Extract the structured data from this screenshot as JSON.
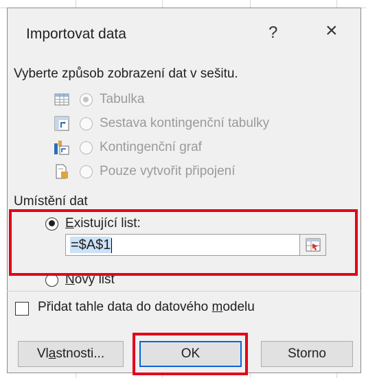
{
  "dialog": {
    "title": "Importovat data",
    "help_label": "?",
    "close_label": "×",
    "display_section": {
      "label": "Vyberte způsob zobrazení dat v sešitu.",
      "options": [
        {
          "icon": "table-icon",
          "label": "Tabulka",
          "selected": true,
          "enabled": false
        },
        {
          "icon": "pivot-table-icon",
          "label": "Sestava kontingenční tabulky",
          "selected": false,
          "enabled": false
        },
        {
          "icon": "pivot-chart-icon",
          "label": "Kontingenční graf",
          "selected": false,
          "enabled": false
        },
        {
          "icon": "connection-icon",
          "label": "Pouze vytvořit připojení",
          "selected": false,
          "enabled": false
        }
      ]
    },
    "location_section": {
      "label": "Umístění dat",
      "existing_sheet": {
        "label_prefix": "E",
        "label_rest": "xistující list:",
        "selected": true
      },
      "reference_value": "=$A$1",
      "new_sheet": {
        "label_prefix": "N",
        "label_rest": "ový list",
        "selected": false
      }
    },
    "data_model_checkbox": {
      "label_start": "Přidat tahle data do datového ",
      "label_hotkey": "m",
      "label_end": "odelu",
      "checked": false
    },
    "buttons": {
      "properties_start": "Vl",
      "properties_hotkey": "a",
      "properties_end": "stnosti...",
      "ok": "OK",
      "cancel": "Storno"
    }
  },
  "colors": {
    "highlight": "#e3001b",
    "default_button_border": "#0a64d6",
    "selection": "#cde1f7"
  }
}
